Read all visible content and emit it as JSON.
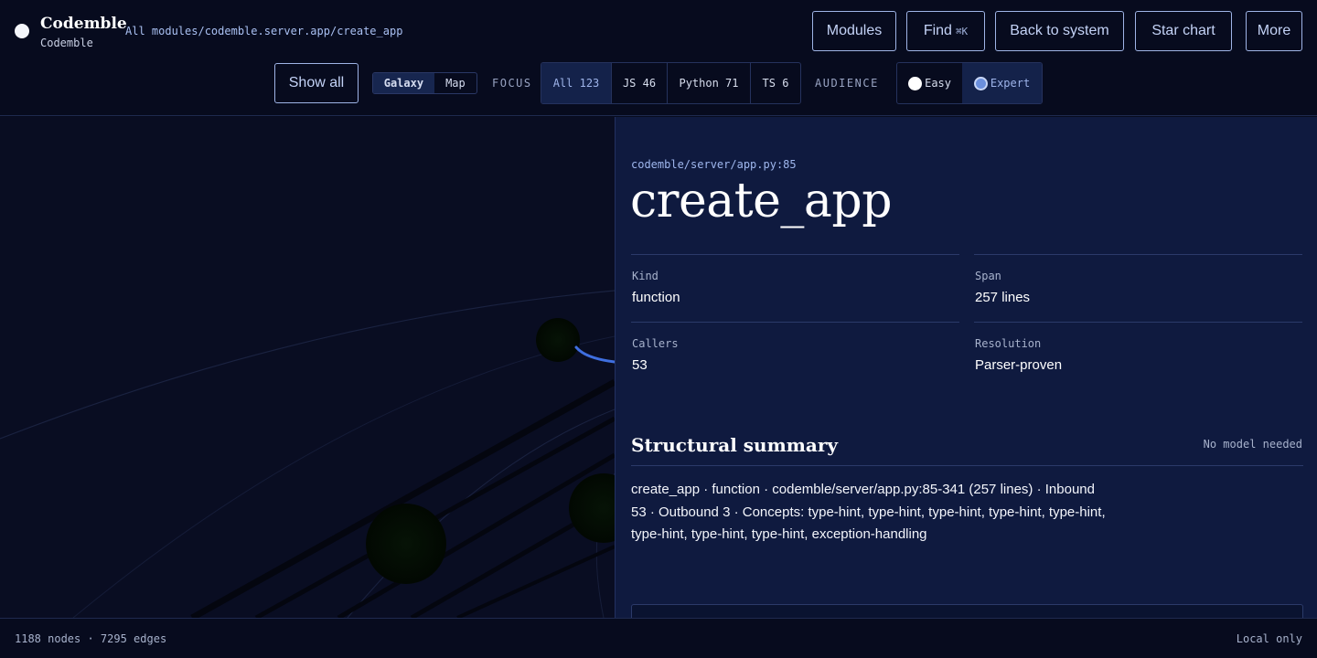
{
  "brand": {
    "name": "Codemble",
    "subtitle": "Codemble"
  },
  "breadcrumb": "All modules/codemble.server.app/create_app",
  "nav": {
    "modules": "Modules",
    "find": "Find",
    "find_shortcut": "⌘K",
    "back": "Back to system",
    "star_chart": "Star chart",
    "more": "More"
  },
  "toolbar": {
    "show_all": "Show all",
    "view": [
      {
        "label": "Galaxy",
        "active": true
      },
      {
        "label": "Map",
        "active": false
      }
    ],
    "focus_label": "FOCUS",
    "focus": [
      {
        "label": "All 123",
        "active": true
      },
      {
        "label": "JS 46"
      },
      {
        "label": "Python 71"
      },
      {
        "label": "TS 6"
      }
    ],
    "audience_label": "AUDIENCE",
    "audience": [
      {
        "label": "Easy",
        "selected": false
      },
      {
        "label": "Expert",
        "selected": true
      }
    ]
  },
  "panel": {
    "file": "codemble/server/app.py:85",
    "title": "create_app",
    "meta": [
      {
        "key": "Kind",
        "value": "function"
      },
      {
        "key": "Span",
        "value": "257 lines"
      },
      {
        "key": "Callers",
        "value": "53"
      },
      {
        "key": "Resolution",
        "value": "Parser-proven"
      }
    ],
    "summary_title": "Structural summary",
    "summary_note": "No model needed",
    "summary_body": "create_app · function · codemble/server/app.py:85-341 (257 lines) · Inbound 53 · Outbound 3 · Concepts: type-hint, type-hint, type-hint, type-hint, type-hint, type-hint, type-hint, type-hint, exception-handling"
  },
  "footer": {
    "stats": "1188 nodes · 7295 edges",
    "local": "Local only"
  },
  "colors": {
    "accent": "#9fb4e6",
    "edge_highlight": "#3f6fe0",
    "panel_bg": "#0f1a3f",
    "page_bg": "#070b1e"
  }
}
